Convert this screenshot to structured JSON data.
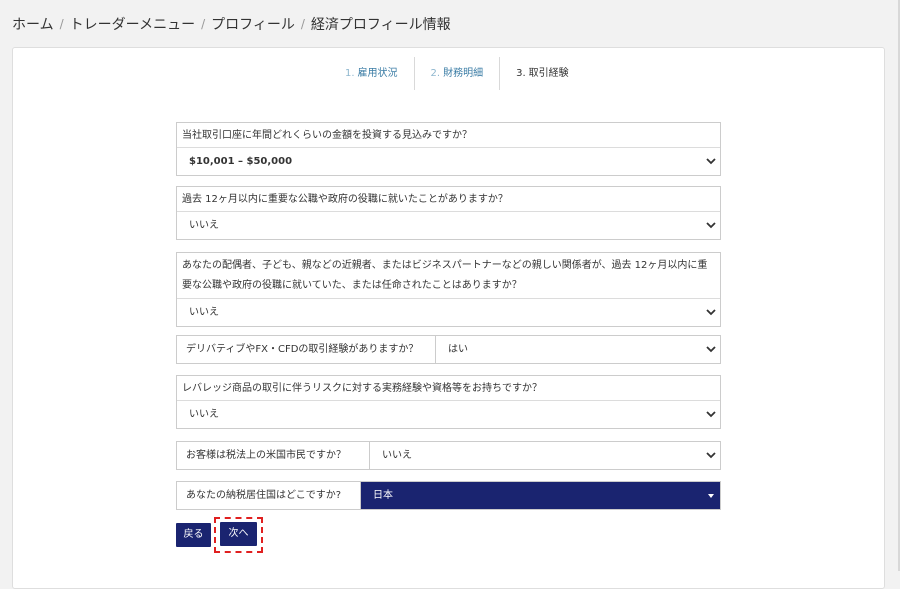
{
  "breadcrumb": {
    "items": [
      "ホーム",
      "トレーダーメニュー",
      "プロフィール",
      "経済プロフィール情報"
    ],
    "separator": "/"
  },
  "steps": [
    {
      "num": "1.",
      "label": "雇用状況"
    },
    {
      "num": "2.",
      "label": "財務明細"
    },
    {
      "num": "3.",
      "label": "取引経験"
    }
  ],
  "questions": {
    "investment_amount": {
      "label": "当社取引口座に年間どれくらいの金額を投資する見込みですか？",
      "value": "$10,001 – $50,000"
    },
    "public_office": {
      "label": "過去 12ヶ月以内に重要な公職や政府の役職に就いたことがありますか？",
      "value": "いいえ"
    },
    "relatives_office": {
      "label": "あなたの配偶者、子ども、親などの近親者、またはビジネスパートナーなどの親しい関係者が、過去 12ヶ月以内に重要な公職や政府の役職に就いていた、または任命されたことはありますか？",
      "value": "いいえ"
    },
    "derivatives": {
      "label": "デリバティブやFX・CFDの取引経験がありますか？",
      "value": "はい"
    },
    "leverage_experience": {
      "label": "レバレッジ商品の取引に伴うリスクに対する実務経験や資格等をお持ちですか？",
      "value": "いいえ"
    },
    "us_citizen": {
      "label": "お客様は税法上の米国市民ですか？",
      "value": "いいえ"
    },
    "tax_residence": {
      "label": "あなたの納税居住国はどこですか?",
      "value": "日本"
    }
  },
  "buttons": {
    "back": "戻る",
    "next": "次へ"
  },
  "colors": {
    "navy": "#1a2470",
    "step_link": "#3a7ca5",
    "highlight": "#e02020"
  },
  "icons": {
    "select": "chevron-down-icon",
    "dropdown": "caret-down-icon"
  }
}
